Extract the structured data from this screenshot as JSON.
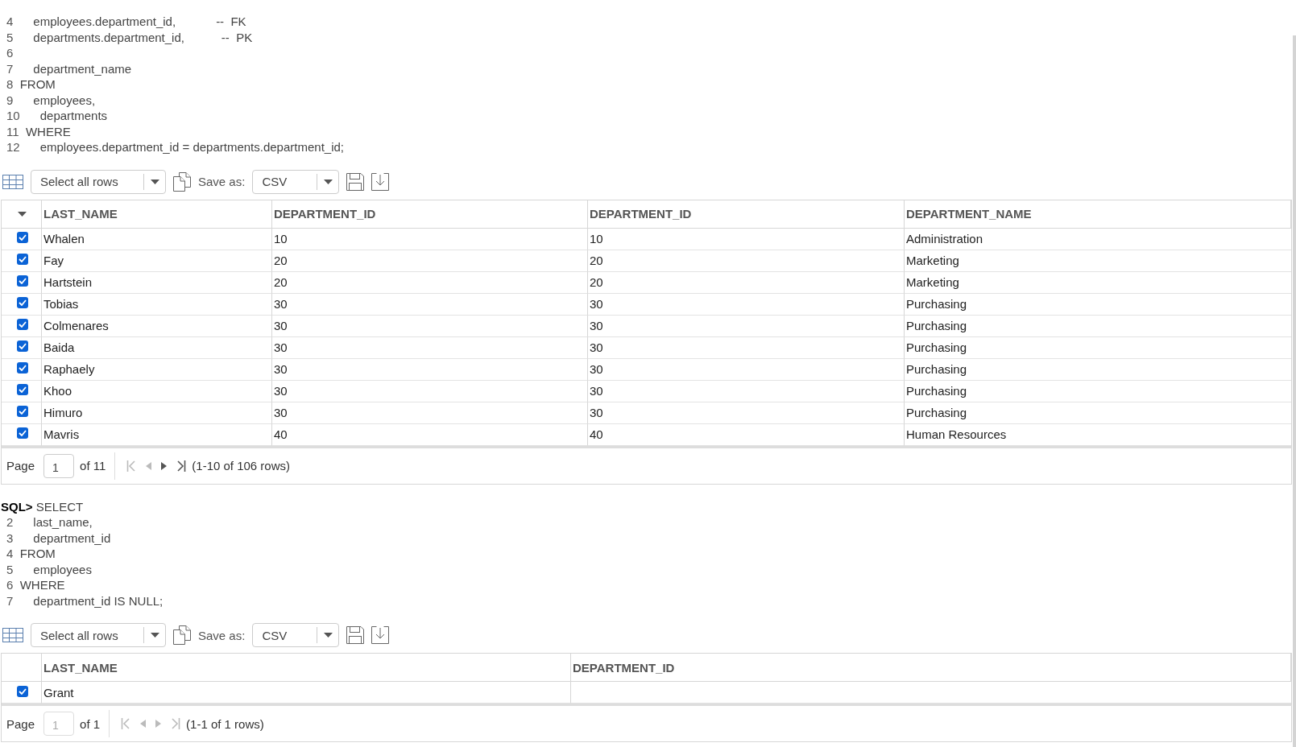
{
  "query_1": {
    "lines": [
      {
        "number": "4",
        "code": "      employees.department_id,            --  FK"
      },
      {
        "number": "5",
        "code": "      departments.department_id,           --  PK"
      },
      {
        "number": "6"
      },
      {
        "number": "7",
        "code": "      department_name"
      },
      {
        "number": "8",
        "code": "  FROM"
      },
      {
        "number": "9",
        "code": "      employees,"
      },
      {
        "number": "10",
        "code": "      departments"
      },
      {
        "number": "11",
        "code": "  WHERE"
      },
      {
        "number": "12",
        "code": "      employees.department_id = departments.department_id;"
      }
    ]
  },
  "results_1": {
    "toolbar": {
      "select": "Select all rows",
      "save_as_label": "Save as:",
      "format": "CSV"
    },
    "columns": [
      "LAST_NAME",
      "DEPARTMENT_ID",
      "DEPARTMENT_ID",
      "DEPARTMENT_NAME"
    ],
    "rows": [
      {
        "selected": true,
        "cells": [
          "Whalen",
          "10",
          "10",
          "Administration"
        ]
      },
      {
        "selected": true,
        "cells": [
          "Fay",
          "20",
          "20",
          "Marketing"
        ]
      },
      {
        "selected": true,
        "cells": [
          "Hartstein",
          "20",
          "20",
          "Marketing"
        ]
      },
      {
        "selected": true,
        "cells": [
          "Tobias",
          "30",
          "30",
          "Purchasing"
        ]
      },
      {
        "selected": true,
        "cells": [
          "Colmenares",
          "30",
          "30",
          "Purchasing"
        ]
      },
      {
        "selected": true,
        "cells": [
          "Baida",
          "30",
          "30",
          "Purchasing"
        ]
      },
      {
        "selected": true,
        "cells": [
          "Raphaely",
          "30",
          "30",
          "Purchasing"
        ]
      },
      {
        "selected": true,
        "cells": [
          "Khoo",
          "30",
          "30",
          "Purchasing"
        ]
      },
      {
        "selected": true,
        "cells": [
          "Himuro",
          "30",
          "30",
          "Purchasing"
        ]
      },
      {
        "selected": true,
        "cells": [
          "Mavris",
          "40",
          "40",
          "Human Resources"
        ]
      }
    ],
    "pagination": {
      "label": "Page",
      "page": "1",
      "page_disabled": false,
      "of": "of 11",
      "summary": "(1-10 of 106 rows)",
      "buttons": [
        {
          "kind": "first",
          "disabled": true
        },
        {
          "kind": "prev",
          "disabled": true
        },
        {
          "kind": "next",
          "disabled": false
        },
        {
          "kind": "last",
          "disabled": false
        }
      ]
    }
  },
  "query_2": {
    "lines": [
      {
        "prompt": "SQL>",
        "code": " SELECT"
      },
      {
        "number": "2",
        "code": "      last_name,"
      },
      {
        "number": "3",
        "code": "      department_id"
      },
      {
        "number": "4",
        "code": "  FROM"
      },
      {
        "number": "5",
        "code": "      employees"
      },
      {
        "number": "6",
        "code": "  WHERE"
      },
      {
        "number": "7",
        "code": "      department_id IS NULL;"
      }
    ]
  },
  "results_2": {
    "toolbar": {
      "select": "Select all rows",
      "save_as_label": "Save as:",
      "format": "CSV"
    },
    "columns": [
      "LAST_NAME",
      "DEPARTMENT_ID"
    ],
    "rows": [
      {
        "selected": true,
        "cells": [
          "Grant"
        ]
      }
    ],
    "pagination": {
      "label": "Page",
      "page": "1",
      "page_disabled": true,
      "of": "of 1",
      "summary": "(1-1 of 1 rows)",
      "buttons": [
        {
          "kind": "first",
          "disabled": true
        },
        {
          "kind": "prev",
          "disabled": true
        },
        {
          "kind": "next",
          "disabled": true
        },
        {
          "kind": "last",
          "disabled": true
        }
      ]
    }
  }
}
